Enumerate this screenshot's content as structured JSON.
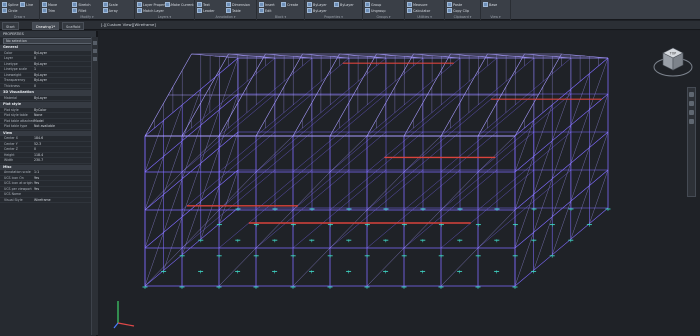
{
  "ribbon": {
    "groups": [
      {
        "label": "Draw",
        "buttons": [
          "Spline",
          "Line",
          "Circle"
        ]
      },
      {
        "label": "Modify",
        "buttons": [
          "Move",
          "Stretch",
          "Scale",
          "Trim",
          "Fillet",
          "Array"
        ]
      },
      {
        "label": "Layers",
        "buttons": [
          "Layer Properties",
          "Make Current",
          "Match Layer"
        ]
      },
      {
        "label": "Annotation",
        "buttons": [
          "Text",
          "Dimension",
          "Leader",
          "Table"
        ]
      },
      {
        "label": "Block",
        "buttons": [
          "Insert",
          "Create",
          "Edit"
        ]
      },
      {
        "label": "Properties",
        "buttons": [
          "ByLayer",
          "ByLayer",
          "ByLayer"
        ]
      },
      {
        "label": "Groups",
        "buttons": [
          "Group",
          "Ungroup"
        ]
      },
      {
        "label": "Utilities",
        "buttons": [
          "Measure",
          "Calculator"
        ]
      },
      {
        "label": "Clipboard",
        "buttons": [
          "Paste",
          "Copy Clip"
        ]
      },
      {
        "label": "View",
        "buttons": [
          "Base"
        ]
      }
    ]
  },
  "file_tabs": [
    "Start",
    "Drawing1*",
    "Scaffold"
  ],
  "viewport_label": "[-][Custom View][Wireframe]",
  "palette": {
    "title": "PROPERTIES",
    "selection": "No selection",
    "sections": [
      {
        "name": "General",
        "rows": [
          [
            "Color",
            "ByLayer"
          ],
          [
            "Layer",
            "0"
          ],
          [
            "Linetype",
            "ByLayer"
          ],
          [
            "Linetype scale",
            "1"
          ],
          [
            "Lineweight",
            "ByLayer"
          ],
          [
            "Transparency",
            "ByLayer"
          ],
          [
            "Thickness",
            "0"
          ]
        ]
      },
      {
        "name": "3D Visualization",
        "rows": [
          [
            "Material",
            "ByLayer"
          ]
        ]
      },
      {
        "name": "Plot style",
        "rows": [
          [
            "Plot style",
            "ByColor"
          ],
          [
            "Plot style table",
            "None"
          ],
          [
            "Plot table attached to",
            "Model"
          ],
          [
            "Plot table type",
            "Not available"
          ]
        ]
      },
      {
        "name": "View",
        "rows": [
          [
            "Center X",
            "184.6"
          ],
          [
            "Center Y",
            "52.3"
          ],
          [
            "Center Z",
            "0"
          ],
          [
            "Height",
            "118.4"
          ],
          [
            "Width",
            "230.7"
          ]
        ]
      },
      {
        "name": "Misc",
        "rows": [
          [
            "Annotation scale",
            "1:1"
          ],
          [
            "UCS icon On",
            "Yes"
          ],
          [
            "UCS icon at origin",
            "Yes"
          ],
          [
            "UCS per viewport",
            "Yes"
          ],
          [
            "UCS Name",
            ""
          ],
          [
            "Visual Style",
            "Wireframe"
          ]
        ]
      }
    ]
  },
  "colors": {
    "frame": "#7f6bff",
    "frame_light": "#a89cff",
    "accent_beam": "#d9433b",
    "base_plate": "#3fd4c4",
    "viewport_bg": "#1f2227"
  },
  "viewcube": {
    "face_label": "TOP"
  },
  "icons": [
    "viewcube-icon",
    "ucs-icon",
    "nav-pan-icon",
    "nav-zoom-icon",
    "nav-orbit-icon"
  ]
}
